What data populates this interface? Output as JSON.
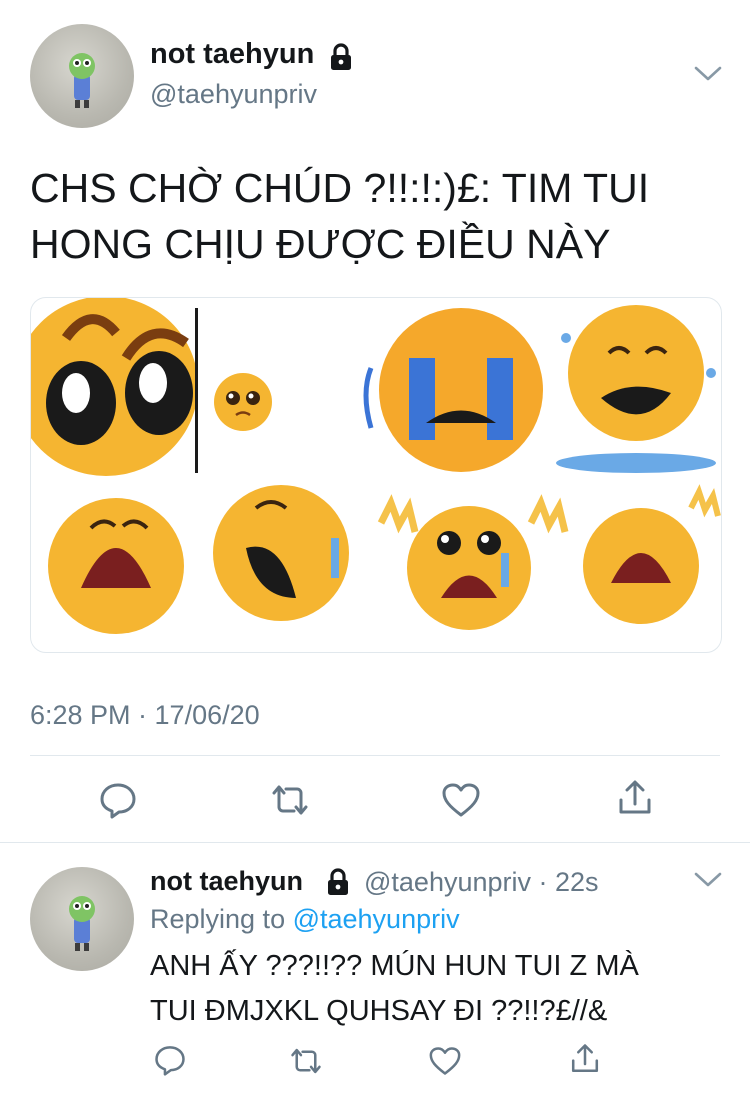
{
  "main_tweet": {
    "display_name": "not taehyun",
    "handle": "@taehyunpriv",
    "text_line1": "CHS CHỜ CHÚD ?!!:!:)£: TIM TUI",
    "text_line2": "HONG CHỊU ĐƯỢC ĐIỀU NÀY",
    "timestamp": "6:28 PM · 17/06/20",
    "icons": {
      "lock": "lock-icon",
      "menu": "chevron-down-icon",
      "reply": "reply-icon",
      "retweet": "retweet-icon",
      "like": "heart-icon",
      "share": "share-icon"
    }
  },
  "reply_tweet": {
    "display_name": "not taehyun",
    "handle_time": "@taehyunpriv · 22s",
    "replying_prefix": "Replying to ",
    "replying_handle": "@taehyunpriv",
    "text_line1": "ANH ẤY ???!!?? MÚN HUN TUI Z MÀ",
    "text_line2": "TUI ĐMJXKL QUHSAY ĐI ??!!?£//&"
  },
  "colors": {
    "accent": "#1da1f2",
    "muted": "#657786",
    "divider": "#e1e8ed",
    "emoji": "#f7b733",
    "tears": "#4a90e2"
  }
}
